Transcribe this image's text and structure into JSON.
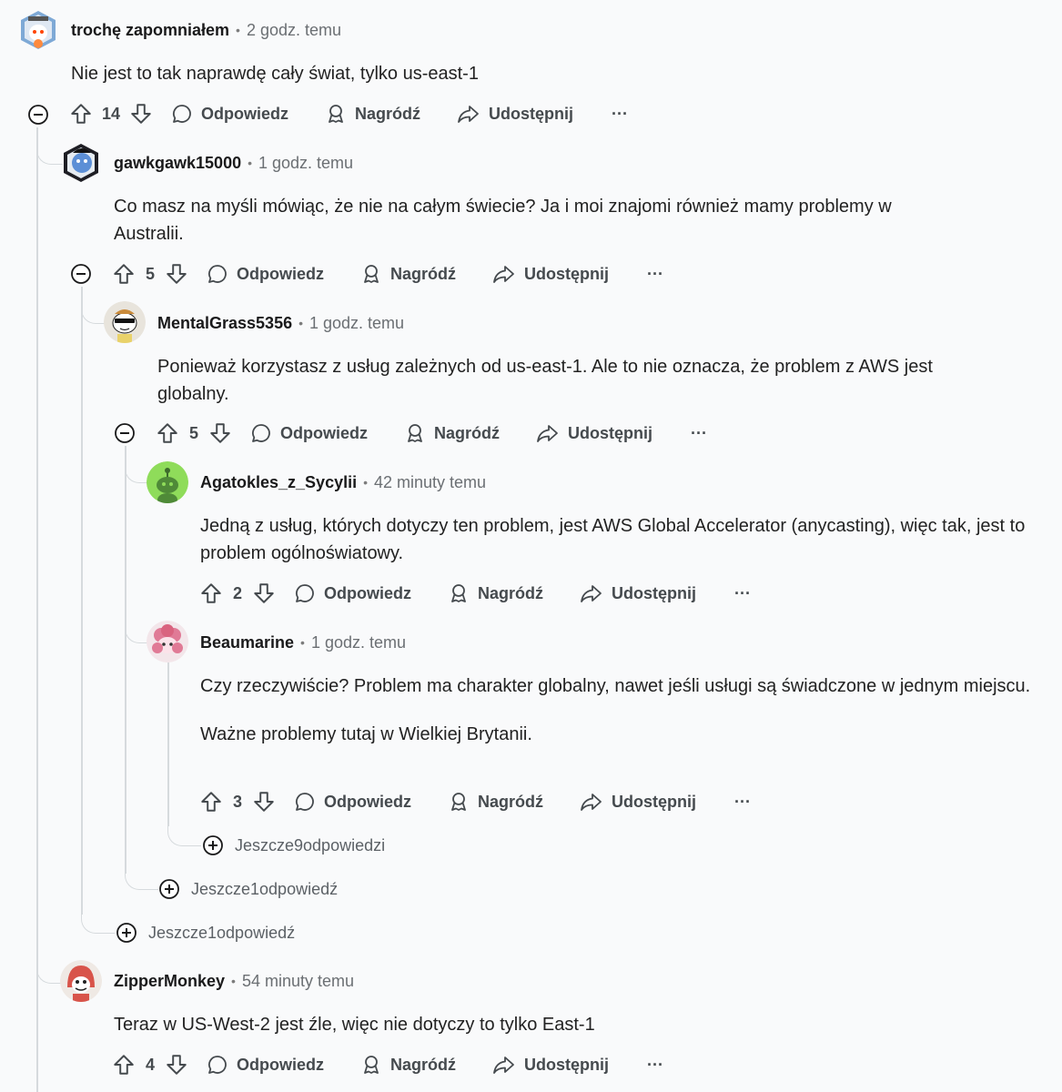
{
  "labels": {
    "reply": "Odpowiedz",
    "award": "Nagródź",
    "share": "Udostępnij",
    "more": "···"
  },
  "comments": [
    {
      "user": "trochę zapomniałem",
      "time": "2 godz. temu",
      "body": [
        "Nie jest to tak naprawdę cały świat, tylko us-east-1"
      ],
      "votes": "14"
    },
    {
      "user": "gawkgawk15000",
      "time": "1 godz. temu",
      "body": [
        "Co masz na myśli mówiąc, że nie na całym świecie? Ja i moi znajomi również mamy problemy w Australii."
      ],
      "votes": "5"
    },
    {
      "user": "MentalGrass5356",
      "time": "1 godz. temu",
      "body": [
        "Ponieważ korzystasz z usług zależnych od us-east-1. Ale to nie oznacza, że problem z AWS jest globalny."
      ],
      "votes": "5"
    },
    {
      "user": "Agatokles_z_Sycylii",
      "time": "42 minuty temu",
      "body": [
        "Jedną z usług, których dotyczy ten problem, jest AWS Global Accelerator (anycasting), więc tak, jest to problem ogólnoświatowy."
      ],
      "votes": "2"
    },
    {
      "user": "Beaumarine",
      "time": "1 godz. temu",
      "body": [
        "Czy rzeczywiście? Problem ma charakter globalny, nawet jeśli usługi są świadczone w jednym miejscu.",
        "Ważne problemy tutaj w Wielkiej Brytanii."
      ],
      "votes": "3"
    },
    {
      "user": "ZipperMonkey",
      "time": "54 minuty temu",
      "body": [
        "Teraz w US-West-2 jest źle, więc nie dotyczy to tylko East-1"
      ],
      "votes": "4"
    }
  ],
  "more_replies": [
    "Jeszcze9odpowiedzi",
    "Jeszcze1odpowiedź",
    "Jeszcze1odpowiedź"
  ],
  "colors": {
    "background": "#f9fafb",
    "thread_line": "#d6dadd",
    "meta_text": "#6b6f73",
    "action_text": "#454a4e"
  }
}
